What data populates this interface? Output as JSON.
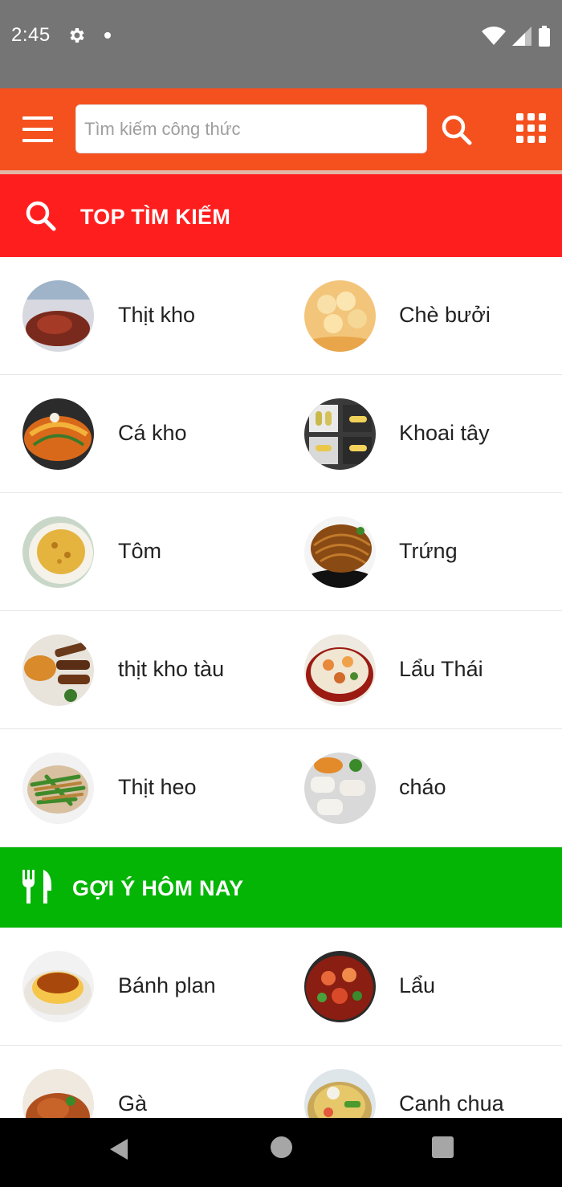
{
  "status_bar": {
    "time": "2:45",
    "icons": [
      "gear-icon",
      "notification-dot-icon",
      "wifi-icon",
      "cell-signal-icon",
      "battery-icon"
    ]
  },
  "app_bar": {
    "background": "#f4511e",
    "search_placeholder": "Tìm kiếm công thức",
    "icons": [
      "menu-icon",
      "search-icon",
      "apps-grid-icon"
    ]
  },
  "sections": {
    "top_search": {
      "title": "TOP TÌM KIẾM",
      "color": "#ff1e1e",
      "icon": "search-icon",
      "items": [
        {
          "label": "Thịt kho",
          "icon": "food-thumbnail"
        },
        {
          "label": "Chè bưởi",
          "icon": "food-thumbnail"
        },
        {
          "label": "Cá kho",
          "icon": "food-thumbnail"
        },
        {
          "label": "Khoai tây",
          "icon": "food-thumbnail"
        },
        {
          "label": "Tôm",
          "icon": "food-thumbnail"
        },
        {
          "label": "Trứng",
          "icon": "food-thumbnail"
        },
        {
          "label": "thịt kho tàu",
          "icon": "food-thumbnail"
        },
        {
          "label": "Lẩu Thái",
          "icon": "food-thumbnail"
        },
        {
          "label": "Thịt heo",
          "icon": "food-thumbnail"
        },
        {
          "label": "cháo",
          "icon": "food-thumbnail"
        }
      ]
    },
    "suggest_today": {
      "title": "GỢI Ý HÔM NAY",
      "color": "#05b506",
      "icon": "fork-knife-icon",
      "items": [
        {
          "label": "Bánh plan",
          "icon": "food-thumbnail"
        },
        {
          "label": "Lẩu",
          "icon": "food-thumbnail"
        },
        {
          "label": "Gà",
          "icon": "food-thumbnail"
        },
        {
          "label": "Canh chua",
          "icon": "food-thumbnail"
        }
      ]
    }
  },
  "nav_bar": {
    "icons": [
      "back-icon",
      "home-icon",
      "recents-icon"
    ]
  }
}
